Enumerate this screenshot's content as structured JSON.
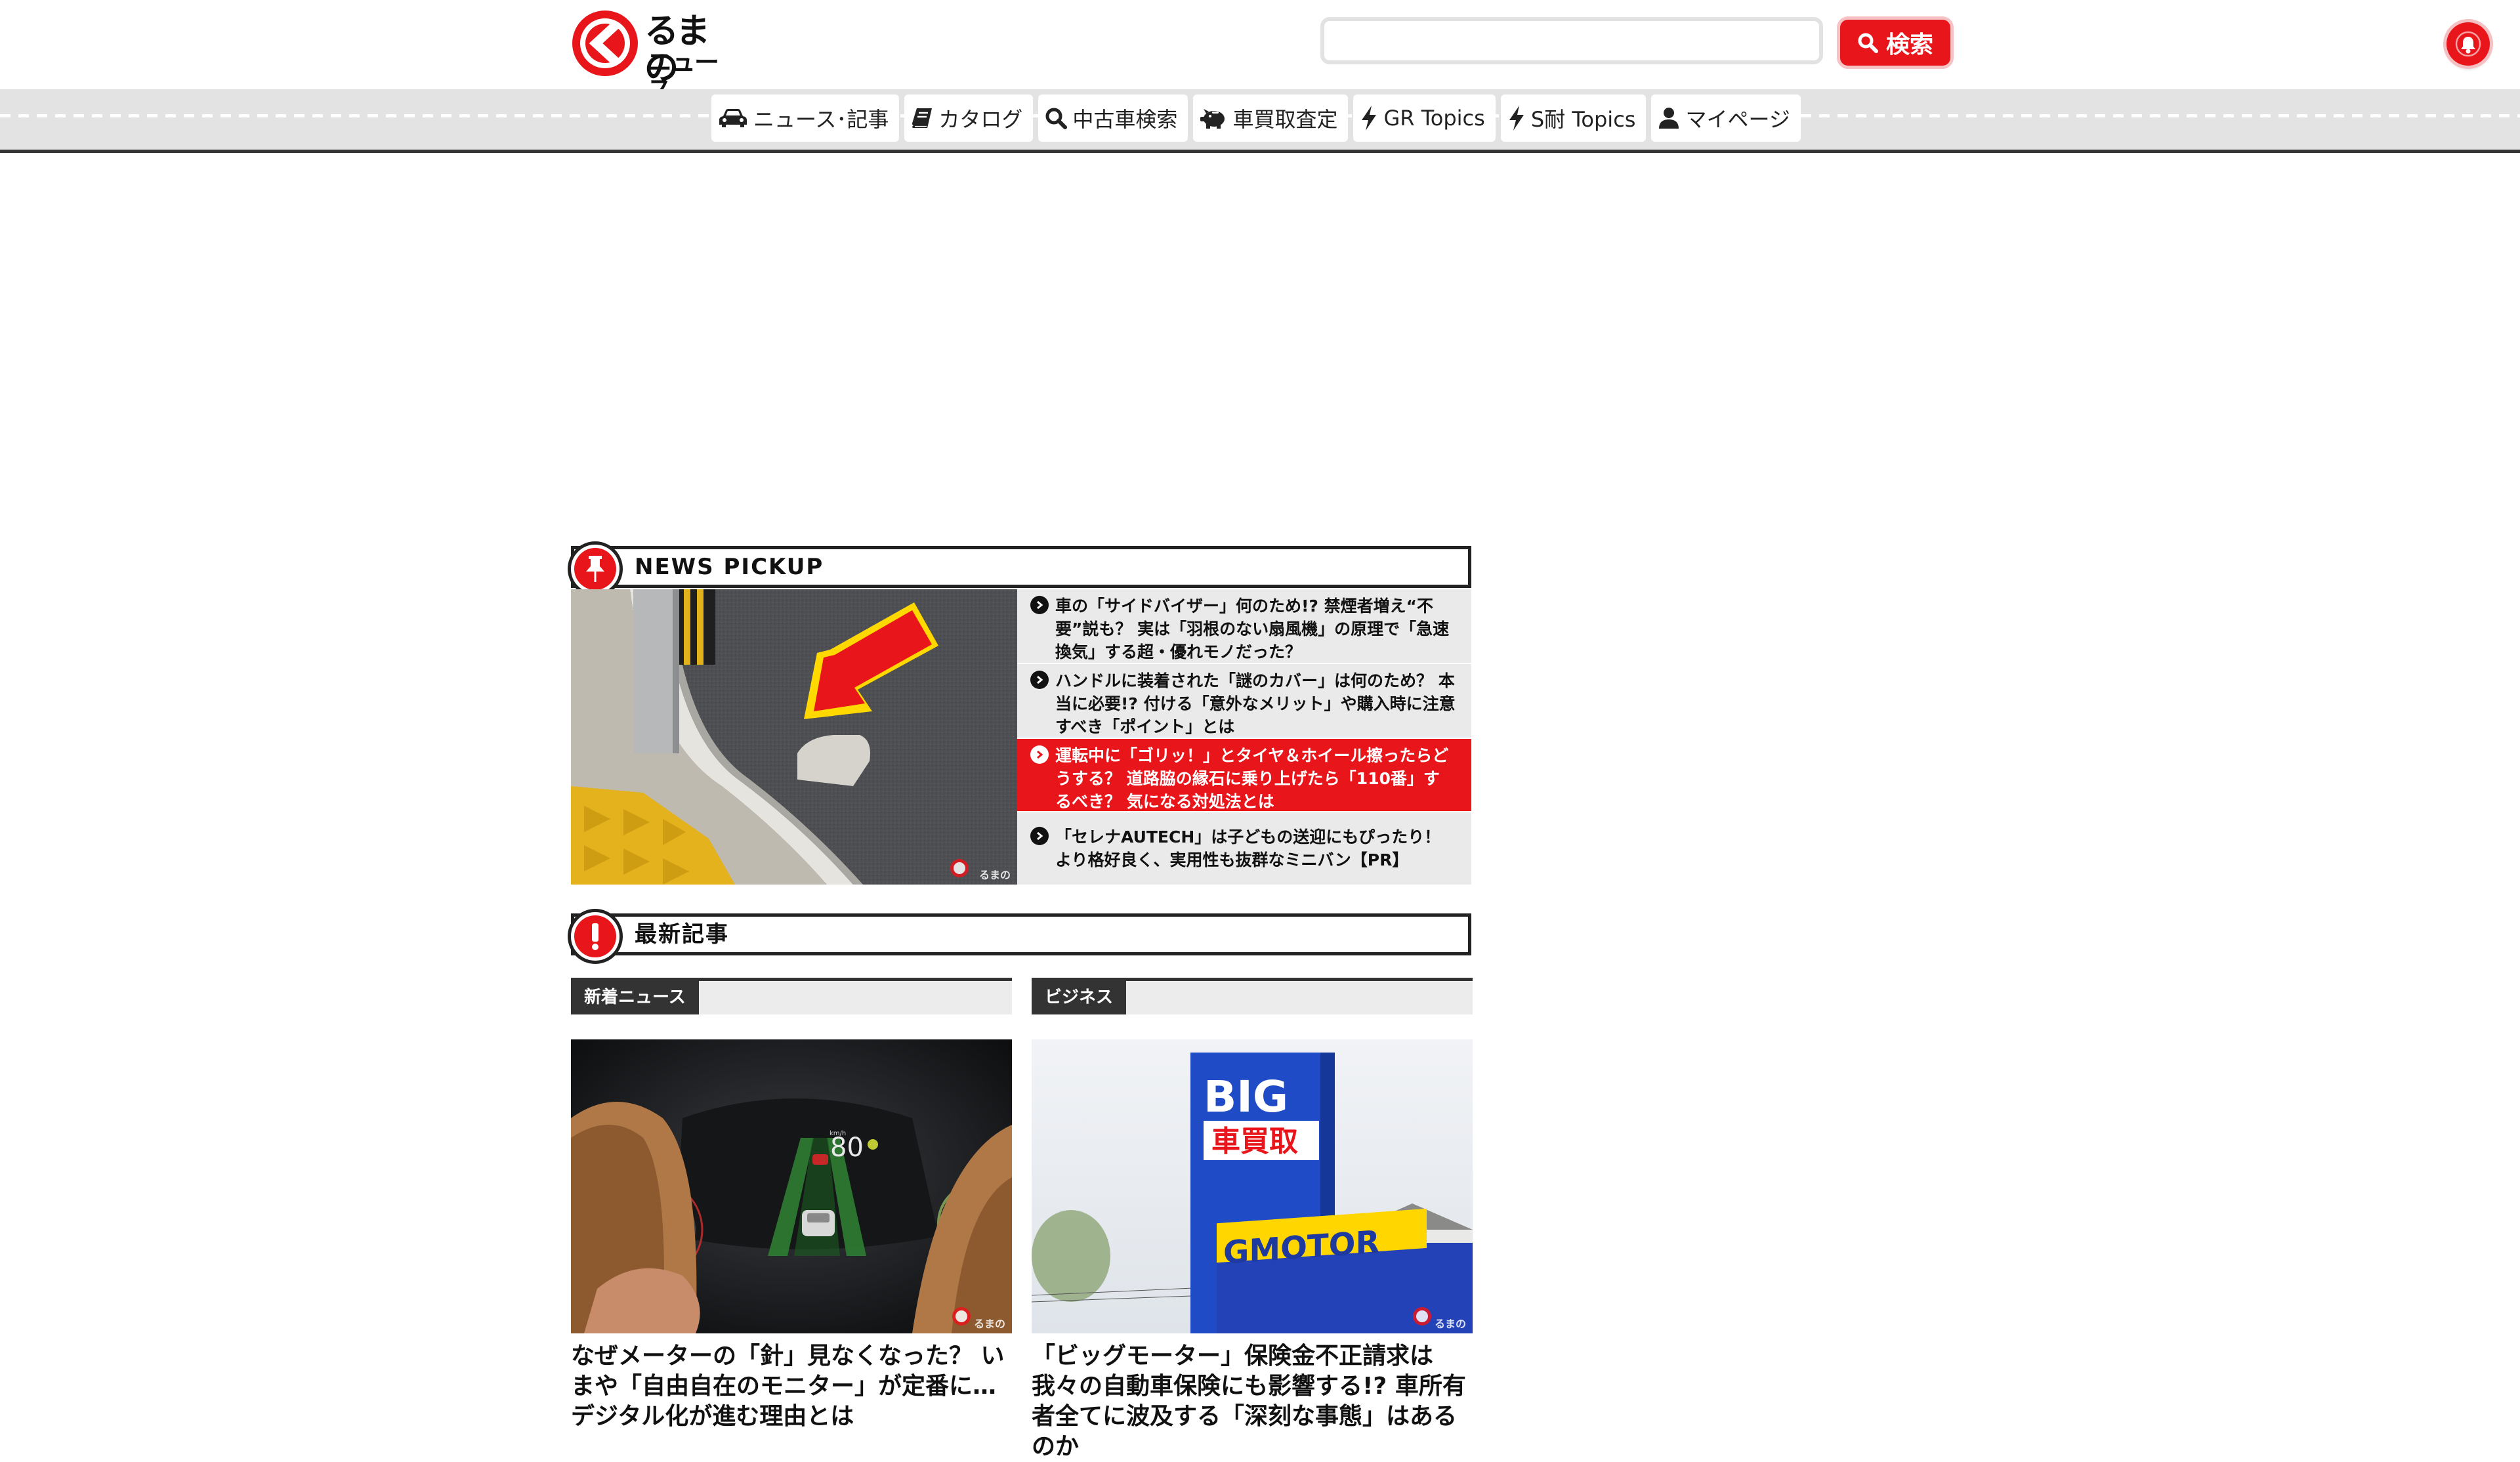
{
  "header": {
    "logo_top": "るまの",
    "logo_bottom": "ニュース",
    "search_placeholder": "",
    "search_button": "検索"
  },
  "nav": {
    "items": [
      {
        "label": "ニュース･記事",
        "icon": "car-icon"
      },
      {
        "label": "カタログ",
        "icon": "book-icon"
      },
      {
        "label": "中古車検索",
        "icon": "search-icon"
      },
      {
        "label": "車買取査定",
        "icon": "piggy-bank-icon"
      },
      {
        "label": "GR Topics",
        "icon": "bolt-icon"
      },
      {
        "label": "S耐 Topics",
        "icon": "bolt-icon"
      },
      {
        "label": "マイページ",
        "icon": "user-icon"
      }
    ]
  },
  "pickup": {
    "title": "NEWS PICKUP",
    "items": [
      {
        "text": "車の「サイドバイザー」何のため!? 禁煙者増え“不要”説も？ 実は「羽根のない扇風機」の原理で「急速換気」する超・優れモノだった？",
        "active": false
      },
      {
        "text": "ハンドルに装着された「謎のカバー」は何のため？ 本当に必要!? 付ける「意外なメリット」や購入時に注意すべき「ポイント」とは",
        "active": false
      },
      {
        "text": "運転中に「ゴリッ！」とタイヤ＆ホイール擦ったらどうする？ 道路脇の縁石に乗り上げたら「110番」するべき？ 気になる対処法とは",
        "active": true
      },
      {
        "text": "「セレナAUTECH」は子どもの送迎にもぴったり！ より格好良く、実用性も抜群なミニバン【PR】",
        "active": false
      }
    ]
  },
  "latest": {
    "title": "最新記事",
    "columns": [
      {
        "category": "新着ニュース",
        "title": "なぜメーターの「針」見なくなった？ いまや「自由自在のモニター」が定番に…デジタル化が進む理由とは",
        "speed": "80",
        "speed_unit": "km/h"
      },
      {
        "category": "ビジネス",
        "title": "「ビッグモーター」保険金不正請求は我々の自動車保険にも影響する!? 車所有者全てに波及する「深刻な事態」はあるのか",
        "sign_big": "BIG",
        "sign_kai": "車買取",
        "sign_motor": "GMOTOR"
      }
    ]
  },
  "watermark": {
    "top": "るまの",
    "bottom": "ニュース"
  },
  "colors": {
    "brand_red": "#e8151b",
    "dark": "#222222",
    "nav_band": "#e3e3e3"
  }
}
